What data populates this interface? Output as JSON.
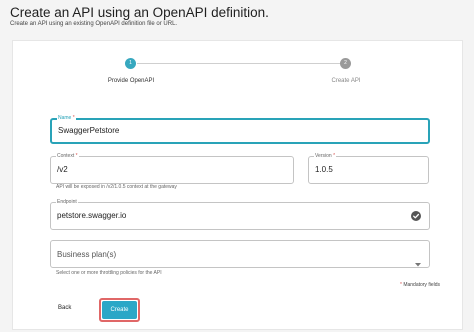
{
  "header": {
    "title": "Create an API using an OpenAPI definition.",
    "subtitle": "Create an API using an existing OpenAPI definition file or URL."
  },
  "stepper": {
    "steps": [
      {
        "number": "1",
        "label": "Provide OpenAPI",
        "state": "completed"
      },
      {
        "number": "2",
        "label": "Create API",
        "state": "pending"
      }
    ],
    "active_color": "#37a8bf",
    "inactive_color": "#9a9a9a"
  },
  "form": {
    "name": {
      "label": "Name",
      "required_mark": "*",
      "value": "SwaggerPetstore"
    },
    "context": {
      "label": "Context",
      "required_mark": "*",
      "value": "/v2",
      "help": "API will be exposed in /v2/1.0.5 context at the gateway"
    },
    "version": {
      "label": "Version",
      "required_mark": "*",
      "value": "1.0.5"
    },
    "endpoint": {
      "label": "Endpoint",
      "value": "petstore.swagger.io",
      "status_icon": "check-circle-icon"
    },
    "business_plans": {
      "placeholder": "Business plan(s)",
      "help": "Select one or more throttling policies for the API",
      "icon": "chevron-down-icon"
    },
    "mandatory_mark": "*",
    "mandatory_text": "Mandatory fields"
  },
  "actions": {
    "back_label": "Back",
    "create_label": "Create",
    "create_color": "#2aa7c7",
    "highlight_color": "#e06767"
  }
}
